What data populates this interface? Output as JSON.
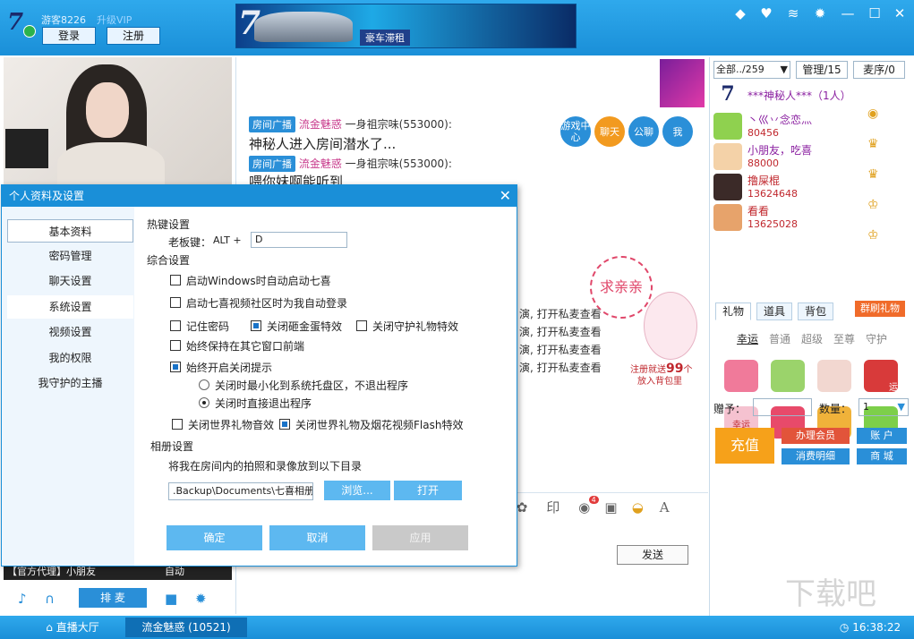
{
  "topbar": {
    "guest_name": "游客8226",
    "upgrade_vip": "升级VIP",
    "login": "登录",
    "register": "注册",
    "banner_text": "豪车滞租",
    "window_icons": [
      "skin-icon",
      "heart-icon",
      "wifi-icon",
      "gear-icon",
      "minimize-icon",
      "maximize-icon",
      "close-icon"
    ]
  },
  "chat": {
    "messages": [
      {
        "badge": "房间广播",
        "from": "流金魅惑",
        "text": "一身祖宗味(553000):"
      },
      {
        "line": "神秘人进入房间潜水了..."
      },
      {
        "badge": "房间广播",
        "from": "流金魅惑",
        "text": "一身祖宗味(553000):"
      },
      {
        "line": "喂你妹啊能听到"
      }
    ],
    "side_lines": [
      "演, 打开私麦查看",
      "演, 打开私麦查看",
      "演, 打开私麦查看",
      "演, 打开私麦查看"
    ],
    "round_buttons": [
      {
        "label": "游戏中心",
        "color": "#2a8fd8"
      },
      {
        "label": "聊天",
        "color": "#f29a1f"
      },
      {
        "label": "公聊",
        "color": "#2a8fd8"
      },
      {
        "label": "我",
        "color": "#2a8fd8"
      }
    ],
    "promo_kiss": "求亲亲",
    "promo_reg": "注册就送",
    "promo_num": "99",
    "promo_unit": "个",
    "promo_bag": "放入背包里",
    "send": "发送",
    "toolbar_badge": "4"
  },
  "right": {
    "all_count": "全部../259",
    "manage": "管理/15",
    "mic_order": "麦序/0",
    "users": [
      {
        "name": "***神秘人***（1人）",
        "id": ""
      },
      {
        "name": "丶巛丷念恋灬",
        "id": "80456"
      },
      {
        "name": "小朋友，吃喜",
        "id": "88000"
      },
      {
        "name": "撸屎棍",
        "id": "13624648"
      },
      {
        "name": "看看",
        "id": "13625028"
      }
    ],
    "tabs": [
      "礼物",
      "道具",
      "背包"
    ],
    "brush_gift": "群刷礼物",
    "subtabs": [
      "幸运",
      "普通",
      "超级",
      "至尊",
      "守护"
    ],
    "gift_labels": [
      "运",
      "幸运"
    ],
    "give_to": "赠予：",
    "quantity": "数量：",
    "qty_value": "1",
    "recharge": "充值",
    "member": "办理会员",
    "account": "账 户",
    "consume": "消费明细",
    "mall": "商 城"
  },
  "video": {
    "ticker": "【官方代理】小朋友　　　　　　　自动"
  },
  "controls": {
    "queue_mic": "排 麦"
  },
  "bottom": {
    "lobby": "直播大厅",
    "room": "流金魅惑 (10521)",
    "clock": "16:38:22",
    "watermark": "下载吧"
  },
  "dialog": {
    "title": "个人资料及设置",
    "nav": [
      "基本资料",
      "密码管理",
      "聊天设置",
      "系统设置",
      "视频设置",
      "我的权限",
      "我守护的主播"
    ],
    "hotkey_title": "热键设置",
    "boss_key_label": "老板键：",
    "boss_key_mod": "ALT +",
    "boss_key_value": "D",
    "general_title": "综合设置",
    "opt_autostart": "启动Windows时自动启动七喜",
    "opt_autologin": "启动七喜视频社区时为我自动登录",
    "opt_remember": "记住密码",
    "opt_egg": "关闭砸金蛋特效",
    "opt_guard": "关闭守护礼物特效",
    "opt_ontop": "始终保持在其它窗口前端",
    "opt_closeprompt": "始终开启关闭提示",
    "radio_tray": "关闭时最小化到系统托盘区，不退出程序",
    "radio_exit": "关闭时直接退出程序",
    "opt_worldsound": "关闭世界礼物音效",
    "opt_worldflash": "关闭世界礼物及烟花视频Flash特效",
    "album_title": "相册设置",
    "album_desc": "将我在房间内的拍照和录像放到以下目录",
    "album_path": ".Backup\\Documents\\七喜相册",
    "browse": "浏览...",
    "open": "打开",
    "ok": "确定",
    "cancel": "取消",
    "apply": "应用"
  }
}
